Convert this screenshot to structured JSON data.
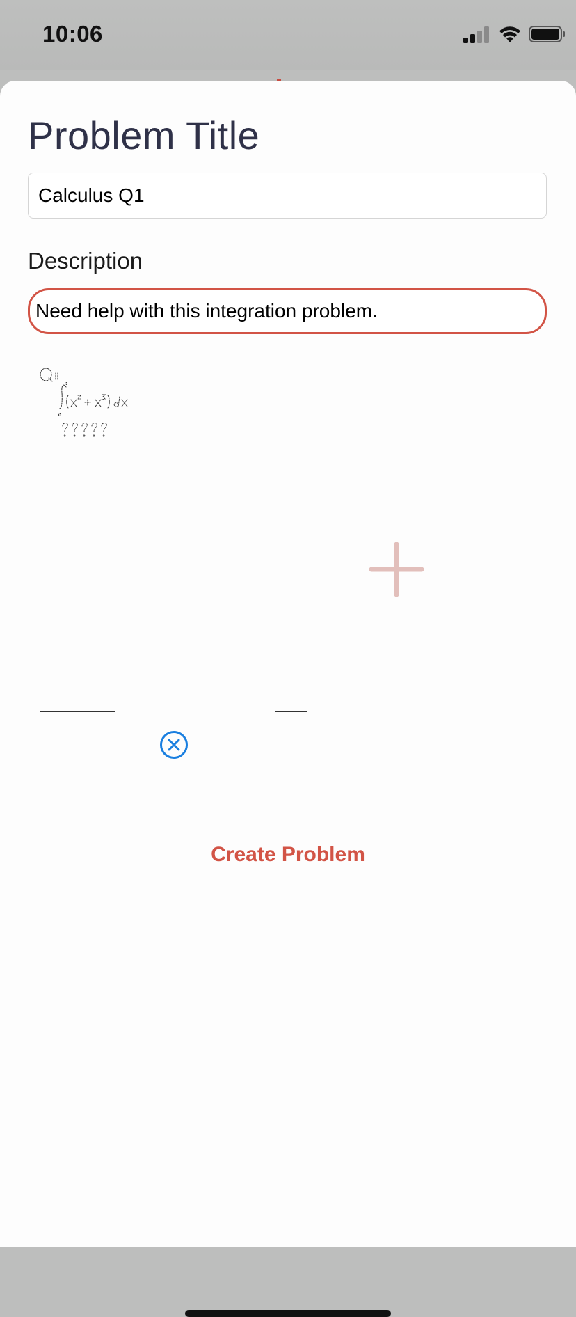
{
  "status_bar": {
    "time": "10:06"
  },
  "form": {
    "title_label": "Problem Title",
    "title_value": "Calculus Q1",
    "description_label": "Description",
    "description_value": "Need help with this integration problem."
  },
  "attachments": {
    "add_icon": "plus-icon",
    "remove_icon": "close-circle-icon"
  },
  "actions": {
    "create_label": "Create Problem"
  },
  "colors": {
    "accent": "#d25446",
    "title_text": "#2f3148",
    "remove_blue": "#1a7fe0",
    "add_pink": "#e2bfbb"
  }
}
